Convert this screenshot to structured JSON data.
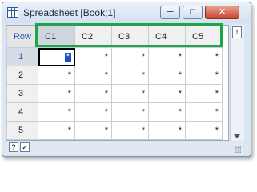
{
  "window": {
    "title": "Spreadsheet [Book;1]"
  },
  "title_buttons": [
    {
      "name": "minimize-button",
      "glyph": "─"
    },
    {
      "name": "maximize-button",
      "glyph": "□"
    },
    {
      "name": "close-button",
      "glyph": "✕"
    }
  ],
  "grid": {
    "row_header_label": "Row",
    "columns": [
      "C1",
      "C2",
      "C3",
      "C4",
      "C5"
    ],
    "rows": [
      {
        "label": "1",
        "cells": [
          "*",
          "*",
          "*",
          "*",
          "*"
        ]
      },
      {
        "label": "2",
        "cells": [
          "*",
          "*",
          "*",
          "*",
          "*"
        ]
      },
      {
        "label": "3",
        "cells": [
          "*",
          "*",
          "*",
          "*",
          "*"
        ]
      },
      {
        "label": "4",
        "cells": [
          "*",
          "*",
          "*",
          "*",
          "*"
        ]
      },
      {
        "label": "5",
        "cells": [
          "*",
          "*",
          "*",
          "*",
          "*"
        ]
      }
    ],
    "selected_cell": {
      "row": 1,
      "column": "C1"
    }
  },
  "scrollbar": {
    "splitter_glyph": "↕"
  },
  "status_bar": {
    "help_label": "?",
    "check_label": "✓"
  },
  "colors": {
    "highlight": "#1ea44a",
    "selection": "#1c4fc4",
    "row_header_text": "#1f5bb3"
  }
}
